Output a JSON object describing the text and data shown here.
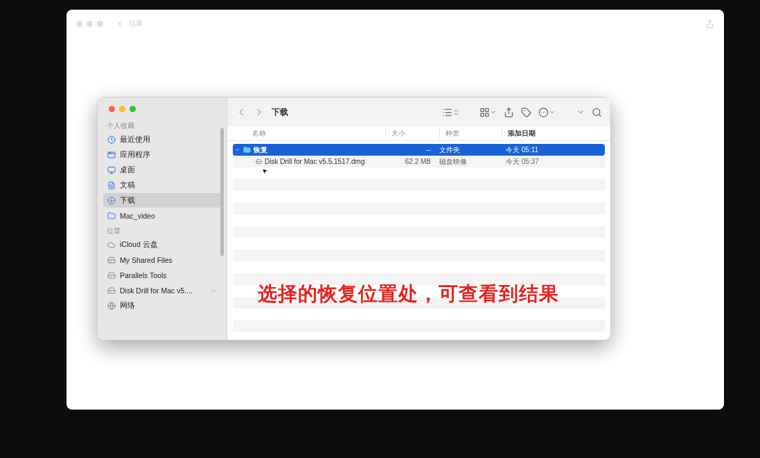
{
  "outer_window": {
    "title": "结果"
  },
  "finder": {
    "path_title": "下载",
    "sidebar": [
      {
        "heading": "个人收藏",
        "items": [
          {
            "label": "最近使用",
            "selected": false
          },
          {
            "label": "应用程序",
            "selected": false
          },
          {
            "label": "桌面",
            "selected": false
          },
          {
            "label": "文稿",
            "selected": false
          },
          {
            "label": "下载",
            "selected": true
          },
          {
            "label": "Mac_video",
            "selected": false
          }
        ]
      },
      {
        "heading": "位置",
        "items": [
          {
            "label": "iCloud 云盘",
            "selected": false
          },
          {
            "label": "My Shared Files",
            "selected": false
          },
          {
            "label": "Parallels Tools",
            "selected": false
          },
          {
            "label": "Disk Drill for Mac v5....",
            "selected": false,
            "ejectable": true
          },
          {
            "label": "网络",
            "selected": false
          }
        ]
      }
    ],
    "columns": [
      {
        "label": "名称",
        "sorted": false
      },
      {
        "label": "大小",
        "sorted": false
      },
      {
        "label": "种类",
        "sorted": false
      },
      {
        "label": "添加日期",
        "sorted": true
      }
    ],
    "rows": [
      {
        "name": "恢复",
        "kind": "folder",
        "size": "--",
        "type": "文件夹",
        "date": "今天 05:11",
        "selected": true,
        "expanded": true,
        "children": [
          {
            "name": "Disk Drill for Mac v5.5.1517.dmg",
            "kind": "file",
            "size": "62.2 MB",
            "type": "磁盘映像",
            "date": "今天 05:37",
            "selected": false
          }
        ]
      }
    ]
  },
  "caption": "选择的恢复位置处，可查看到结果"
}
